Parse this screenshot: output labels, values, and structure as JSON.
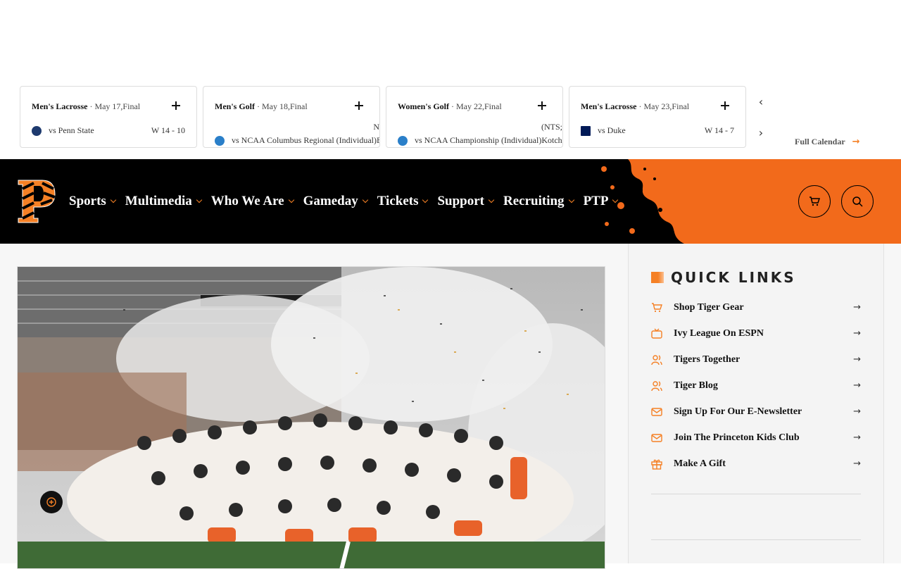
{
  "scoreboard": {
    "games": [
      {
        "sport": "Men's Lacrosse",
        "meta": "May 17,Final",
        "opponent": "vs Penn State",
        "result": "W 14 - 10",
        "logo_color": "#1e3a6e",
        "overflow_note": ""
      },
      {
        "sport": "Men's Golf",
        "meta": "May 18,Final",
        "opponent": "vs NCAA Columbus Regional (Individual)B",
        "result": "",
        "logo_color": "#2a7fc9",
        "overflow_note": "N"
      },
      {
        "sport": "Women's Golf",
        "meta": "May 22,Final",
        "opponent": "vs NCAA Championship (Individual)Kotch",
        "result": "",
        "logo_color": "#2a7fc9",
        "overflow_note": "(NTS;"
      },
      {
        "sport": "Men's Lacrosse",
        "meta": "May 23,Final",
        "opponent": "vs Duke",
        "result": "W 14 - 7",
        "logo_color": "#001a57",
        "overflow_note": ""
      }
    ],
    "prev_icon": "chevron-left-icon",
    "next_icon": "chevron-right-icon",
    "full_calendar_label": "Full Calendar"
  },
  "nav": {
    "menu": [
      "Sports",
      "Multimedia",
      "Who We Are",
      "Gameday",
      "Tickets",
      "Support",
      "Recruiting",
      "PTP"
    ],
    "accent": "#f26a1b",
    "cart_icon": "cart-icon",
    "search_icon": "search-icon"
  },
  "quick_links": {
    "title": "QUICK LINKS",
    "items": [
      {
        "label": "Shop Tiger Gear",
        "icon": "cart-icon"
      },
      {
        "label": "Ivy League On ESPN",
        "icon": "tv-icon"
      },
      {
        "label": "Tigers Together",
        "icon": "users-icon"
      },
      {
        "label": "Tiger Blog",
        "icon": "users-icon"
      },
      {
        "label": "Sign Up For Our E-Newsletter",
        "icon": "mail-icon"
      },
      {
        "label": "Join The Princeton Kids Club",
        "icon": "mail-icon"
      },
      {
        "label": "Make A Gift",
        "icon": "gift-icon"
      }
    ]
  },
  "hero": {
    "image_alt": "team-celebration-photo"
  }
}
